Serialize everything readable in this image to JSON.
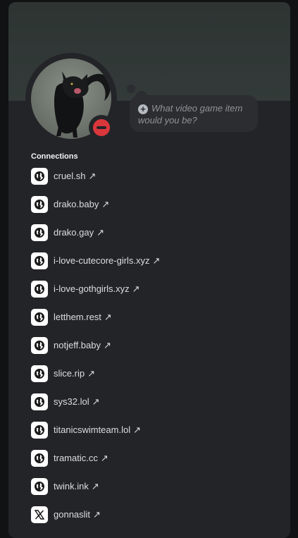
{
  "profile": {
    "custom_status_placeholder": "What video game item would you be?",
    "status": "do-not-disturb",
    "status_color": "#da373c"
  },
  "connections": {
    "title": "Connections",
    "arrow": "↗",
    "items": [
      {
        "label": "cruel.sh",
        "icon": "globe-icon"
      },
      {
        "label": "drako.baby",
        "icon": "globe-icon"
      },
      {
        "label": "drako.gay",
        "icon": "globe-icon"
      },
      {
        "label": "i-love-cutecore-girls.xyz",
        "icon": "globe-icon"
      },
      {
        "label": "i-love-gothgirls.xyz",
        "icon": "globe-icon"
      },
      {
        "label": "letthem.rest",
        "icon": "globe-icon"
      },
      {
        "label": "notjeff.baby",
        "icon": "globe-icon"
      },
      {
        "label": "slice.rip",
        "icon": "globe-icon"
      },
      {
        "label": "sys32.lol",
        "icon": "globe-icon"
      },
      {
        "label": "titanicswimteam.lol",
        "icon": "globe-icon"
      },
      {
        "label": "tramatic.cc",
        "icon": "globe-icon"
      },
      {
        "label": "twink.ink",
        "icon": "globe-icon"
      },
      {
        "label": "gonnaslit",
        "icon": "x-logo-icon"
      }
    ]
  },
  "colors": {
    "card_bg": "#232428",
    "banner": "#333a39",
    "text": "#dbdee1"
  }
}
